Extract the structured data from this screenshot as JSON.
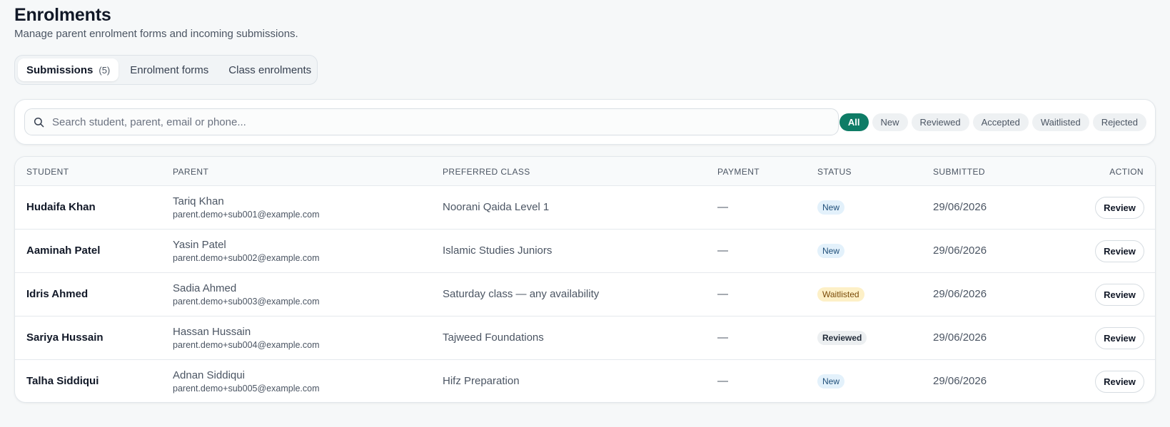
{
  "page": {
    "title": "Enrolments",
    "subtitle": "Manage parent enrolment forms and incoming submissions."
  },
  "tabs": [
    {
      "label": "Submissions",
      "count": "(5)",
      "active": true
    },
    {
      "label": "Enrolment forms",
      "active": false
    },
    {
      "label": "Class enrolments",
      "active": false
    }
  ],
  "search": {
    "placeholder": "Search student, parent, email or phone...",
    "value": "",
    "icon": "search-icon"
  },
  "filters": [
    {
      "label": "All",
      "active": true
    },
    {
      "label": "New",
      "active": false
    },
    {
      "label": "Reviewed",
      "active": false
    },
    {
      "label": "Accepted",
      "active": false
    },
    {
      "label": "Waitlisted",
      "active": false
    },
    {
      "label": "Rejected",
      "active": false
    }
  ],
  "table": {
    "headers": {
      "student": "STUDENT",
      "parent": "PARENT",
      "preferred_class": "PREFERRED CLASS",
      "payment": "PAYMENT",
      "status": "STATUS",
      "submitted": "SUBMITTED",
      "action": "ACTION"
    },
    "rows": [
      {
        "student": "Hudaifa Khan",
        "parent_name": "Tariq Khan",
        "parent_email": "parent.demo+sub001@example.com",
        "preferred_class": "Noorani Qaida Level 1",
        "payment": "—",
        "status": "New",
        "status_kind": "new",
        "submitted": "29/06/2026",
        "action": "Review"
      },
      {
        "student": "Aaminah Patel",
        "parent_name": "Yasin Patel",
        "parent_email": "parent.demo+sub002@example.com",
        "preferred_class": "Islamic Studies Juniors",
        "payment": "—",
        "status": "New",
        "status_kind": "new",
        "submitted": "29/06/2026",
        "action": "Review"
      },
      {
        "student": "Idris Ahmed",
        "parent_name": "Sadia Ahmed",
        "parent_email": "parent.demo+sub003@example.com",
        "preferred_class": "Saturday class — any availability",
        "payment": "—",
        "status": "Waitlisted",
        "status_kind": "waitlisted",
        "submitted": "29/06/2026",
        "action": "Review"
      },
      {
        "student": "Sariya Hussain",
        "parent_name": "Hassan Hussain",
        "parent_email": "parent.demo+sub004@example.com",
        "preferred_class": "Tajweed Foundations",
        "payment": "—",
        "status": "Reviewed",
        "status_kind": "reviewed",
        "submitted": "29/06/2026",
        "action": "Review"
      },
      {
        "student": "Talha Siddiqui",
        "parent_name": "Adnan Siddiqui",
        "parent_email": "parent.demo+sub005@example.com",
        "preferred_class": "Hifz Preparation",
        "payment": "—",
        "status": "New",
        "status_kind": "new",
        "submitted": "29/06/2026",
        "action": "Review"
      }
    ]
  },
  "colors": {
    "accent": "#0e7c66",
    "status_new_bg": "#e3f1fb",
    "status_waitlisted_bg": "#fdf0c7",
    "status_reviewed_bg": "#eceff1"
  }
}
